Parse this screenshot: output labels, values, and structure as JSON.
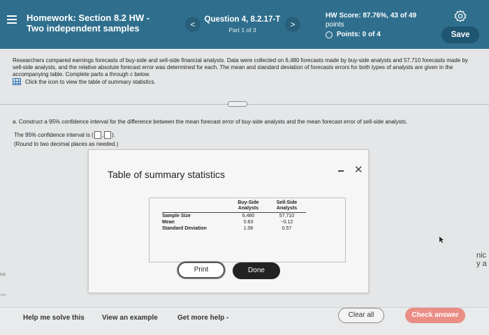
{
  "header": {
    "title_line1": "Homework: Section 8.2 HW -",
    "title_line2": "Two independent samples",
    "question_title": "Question 4, 8.2.17-T",
    "question_part": "Part 1 of 3",
    "prev_icon": "<",
    "next_icon": ">",
    "score_line1": "HW Score: 87.76%, 43 of 49",
    "score_line2": "points",
    "points_label": "Points: 0 of 4",
    "save_label": "Save"
  },
  "content": {
    "intro": "Researchers compared earnings forecasts of buy-side and sell-side financial analysts. Data were collected on 6,480 forecasts made by buy-side analysts and 57,710 forecasts made by sell-side analysts, and the relative absolute forecast error was determined for each. The mean and standard deviation of forecasts errors for both types of analysts are given in the accompanying table. Complete parts a through c below.",
    "table_link": "Click the icon to view the table of summary statistics.",
    "part_a": "a. Construct a 95% confidence interval for the difference between the mean forecast error of buy-side analysts and the mean forecast error of sell-side analysts.",
    "ci_prefix": "The 95% confidence interval is (",
    "ci_comma": ",",
    "ci_suffix": ").",
    "round_note": "(Round to two decimal places as needed.)"
  },
  "modal": {
    "title": "Table of summary statistics",
    "minimize_icon": "-",
    "close_icon": "✕",
    "columns": [
      {
        "line1": "Buy-Side",
        "line2": "Analysts"
      },
      {
        "line1": "Sell-Side",
        "line2": "Analysts"
      }
    ],
    "rows": [
      {
        "label": "Sample Size",
        "buy": "6,480",
        "sell": "57,710"
      },
      {
        "label": "Mean",
        "buy": "0.83",
        "sell": "−0.12"
      },
      {
        "label": "Standard Deviation",
        "buy": "1.06",
        "sell": "0.57"
      }
    ],
    "print_label": "Print",
    "done_label": "Done"
  },
  "side": {
    "left_fragment": "ea",
    "left_fragment2": "omr",
    "right_line1": "nic",
    "right_line2": "y a"
  },
  "footer": {
    "help_label": "Help me solve this",
    "example_label": "View an example",
    "more_help_label": "Get more help -",
    "clear_label": "Clear all",
    "check_label": "Check answer"
  },
  "colors": {
    "header_bg": "#2f6f8d",
    "save_bg": "#1e5570",
    "check_bg": "#ea8d85"
  },
  "icons": [
    "menu-icon",
    "chevron-left-icon",
    "chevron-right-icon",
    "gear-icon",
    "table-grid-icon",
    "minimize-icon",
    "close-icon",
    "cursor-icon"
  ]
}
